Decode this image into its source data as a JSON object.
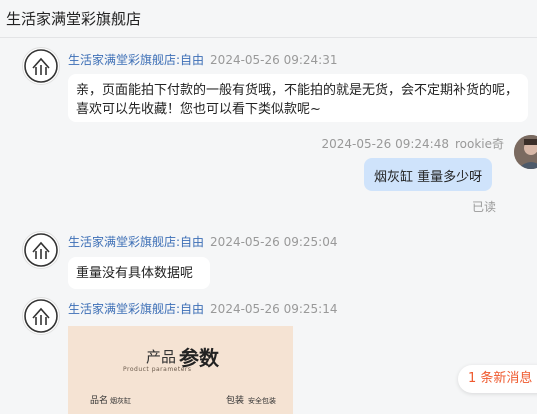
{
  "header": {
    "title": "生活家满堂彩旗舰店"
  },
  "messages": [
    {
      "sender": "生活家满堂彩旗舰店:自由",
      "time": "2024-05-26 09:24:31",
      "text": "亲，页面能拍下付款的一般有货哦，不能拍的就是无货，会不定期补货的呢，喜欢可以先收藏！您也可以看下类似款呢~"
    },
    {
      "sender": "rookie奇",
      "time": "2024-05-26 09:24:48",
      "text": "烟灰缸  重量多少呀",
      "status": "已读"
    },
    {
      "sender": "生活家满堂彩旗舰店:自由",
      "time": "2024-05-26 09:25:04",
      "text": "重量没有具体数据呢"
    },
    {
      "sender": "生活家满堂彩旗舰店:自由",
      "time": "2024-05-26 09:25:14",
      "image": {
        "title_small": "产品",
        "title_big": "参数",
        "subtitle": "Product parameters",
        "row1_label": "品名",
        "row1_value": "烟灰缸",
        "row2_label": "包装",
        "row2_value": "安全包装"
      }
    }
  ],
  "new_message_notice": "1 条新消息"
}
